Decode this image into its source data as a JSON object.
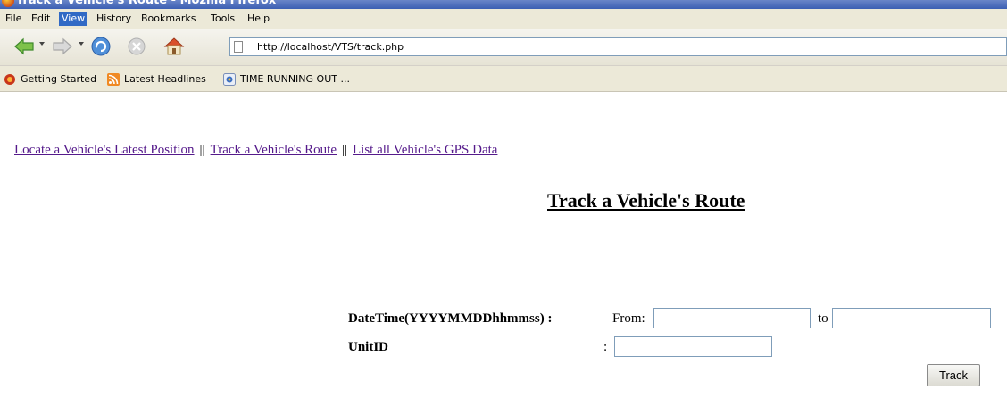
{
  "window": {
    "title": "Track a Vehicle's Route - Mozilla Firefox"
  },
  "menu": {
    "items": [
      "File",
      "Edit",
      "View",
      "History",
      "Bookmarks",
      "Tools",
      "Help"
    ],
    "active": "View"
  },
  "toolbar": {
    "url": "http://localhost/VTS/track.php",
    "icons": [
      "back-icon",
      "forward-icon",
      "reload-icon",
      "stop-icon",
      "home-icon",
      "page-icon"
    ]
  },
  "bookmarks": {
    "items": [
      {
        "label": "Getting Started",
        "icon": "firefox-icon"
      },
      {
        "label": "Latest Headlines",
        "icon": "rss-icon"
      },
      {
        "label": "TIME RUNNING OUT ...",
        "icon": "bookmark-page-icon"
      }
    ]
  },
  "page": {
    "nav_links": [
      "Locate a Vehicle's Latest Position",
      "Track a Vehicle's Route",
      "List all Vehicle's GPS Data"
    ],
    "separator": "||",
    "heading": "Track a Vehicle's Route",
    "form": {
      "datetime_label": "DateTime(YYYYMMDDhhmmss) :",
      "from_label": "From:",
      "from_value": "",
      "to_label": "to",
      "to_value": "",
      "unitid_label": "UnitID",
      "unitid_colon": ":",
      "unitid_value": "",
      "submit_label": "Track"
    }
  },
  "colors": {
    "link_visited": "#551a8b",
    "menu_highlight": "#316ac5",
    "chrome_bg": "#ece9d8"
  }
}
